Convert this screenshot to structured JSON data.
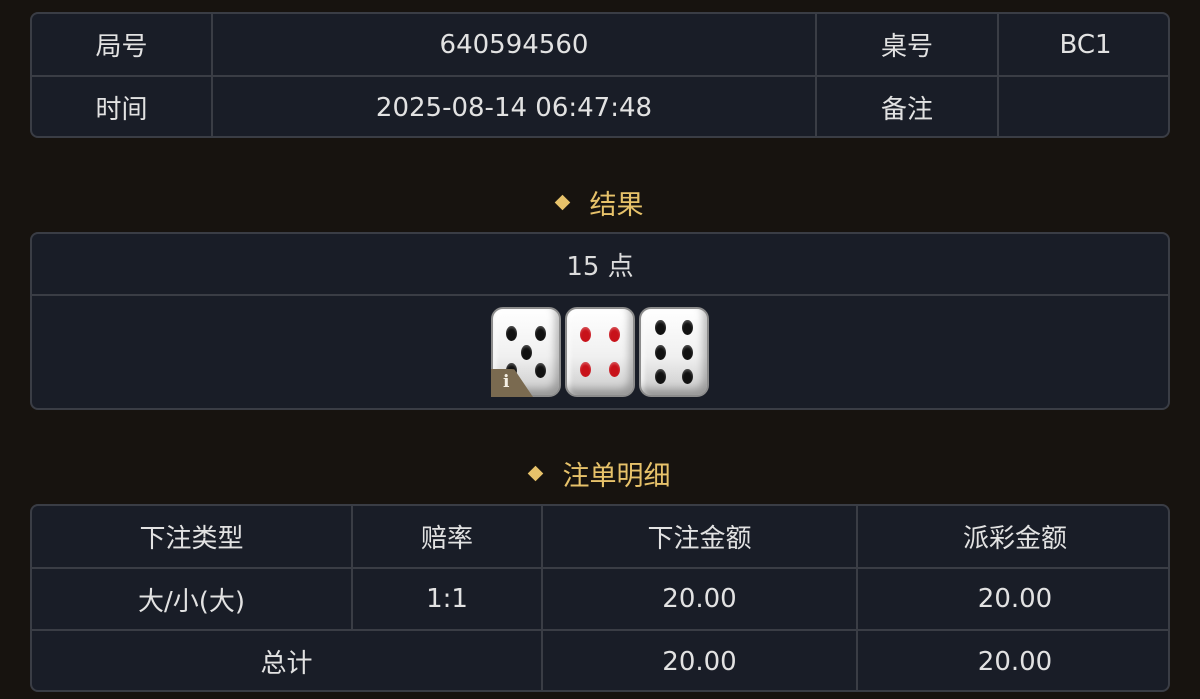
{
  "info": {
    "round_label": "局号",
    "round_value": "640594560",
    "table_label": "桌号",
    "table_value": "BC1",
    "time_label": "时间",
    "time_value": "2025-08-14 06:47:48",
    "remark_label": "备注",
    "remark_value": ""
  },
  "result": {
    "section_title": "结果",
    "points_text": "15 点",
    "dice": [
      5,
      4,
      6
    ],
    "info_icon_text": "i"
  },
  "bets": {
    "section_title": "注单明细",
    "headers": [
      "下注类型",
      "赔率",
      "下注金额",
      "派彩金额"
    ],
    "rows": [
      {
        "type": "大/小(大)",
        "odds": "1:1",
        "bet": "20.00",
        "payout": "20.00"
      }
    ],
    "total": {
      "label": "总计",
      "bet": "20.00",
      "payout": "20.00"
    }
  },
  "colors": {
    "accent_gold": "#e7c26a",
    "odds_red": "#d2191f",
    "panel_bg": "#191d27",
    "page_bg": "#17130f"
  }
}
